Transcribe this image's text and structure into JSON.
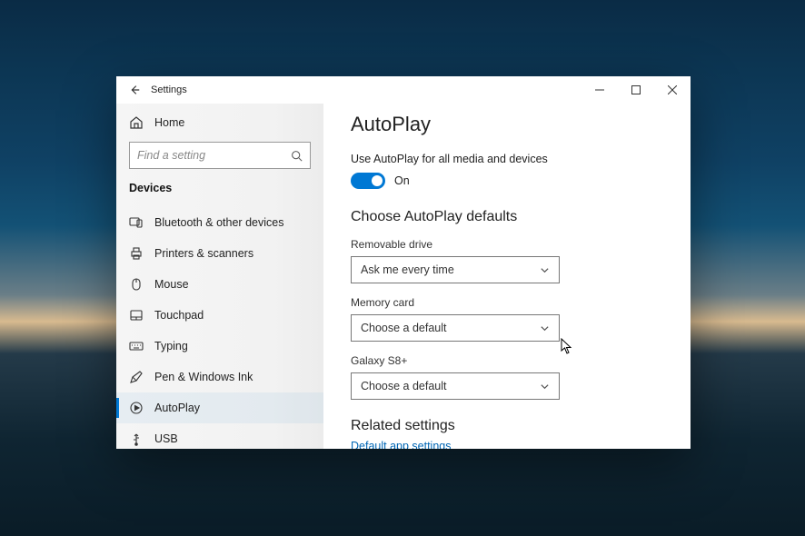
{
  "window": {
    "title": "Settings"
  },
  "sidebar": {
    "home_label": "Home",
    "search_placeholder": "Find a setting",
    "section_label": "Devices",
    "items": [
      {
        "label": "Bluetooth & other devices"
      },
      {
        "label": "Printers & scanners"
      },
      {
        "label": "Mouse"
      },
      {
        "label": "Touchpad"
      },
      {
        "label": "Typing"
      },
      {
        "label": "Pen & Windows Ink"
      },
      {
        "label": "AutoPlay"
      },
      {
        "label": "USB"
      }
    ]
  },
  "content": {
    "page_title": "AutoPlay",
    "toggle_caption": "Use AutoPlay for all media and devices",
    "toggle_state_label": "On",
    "defaults_heading": "Choose AutoPlay defaults",
    "fields": [
      {
        "label": "Removable drive",
        "value": "Ask me every time"
      },
      {
        "label": "Memory card",
        "value": "Choose a default"
      },
      {
        "label": "Galaxy S8+",
        "value": "Choose a default"
      }
    ],
    "related_heading": "Related settings",
    "related_link": "Default app settings"
  }
}
